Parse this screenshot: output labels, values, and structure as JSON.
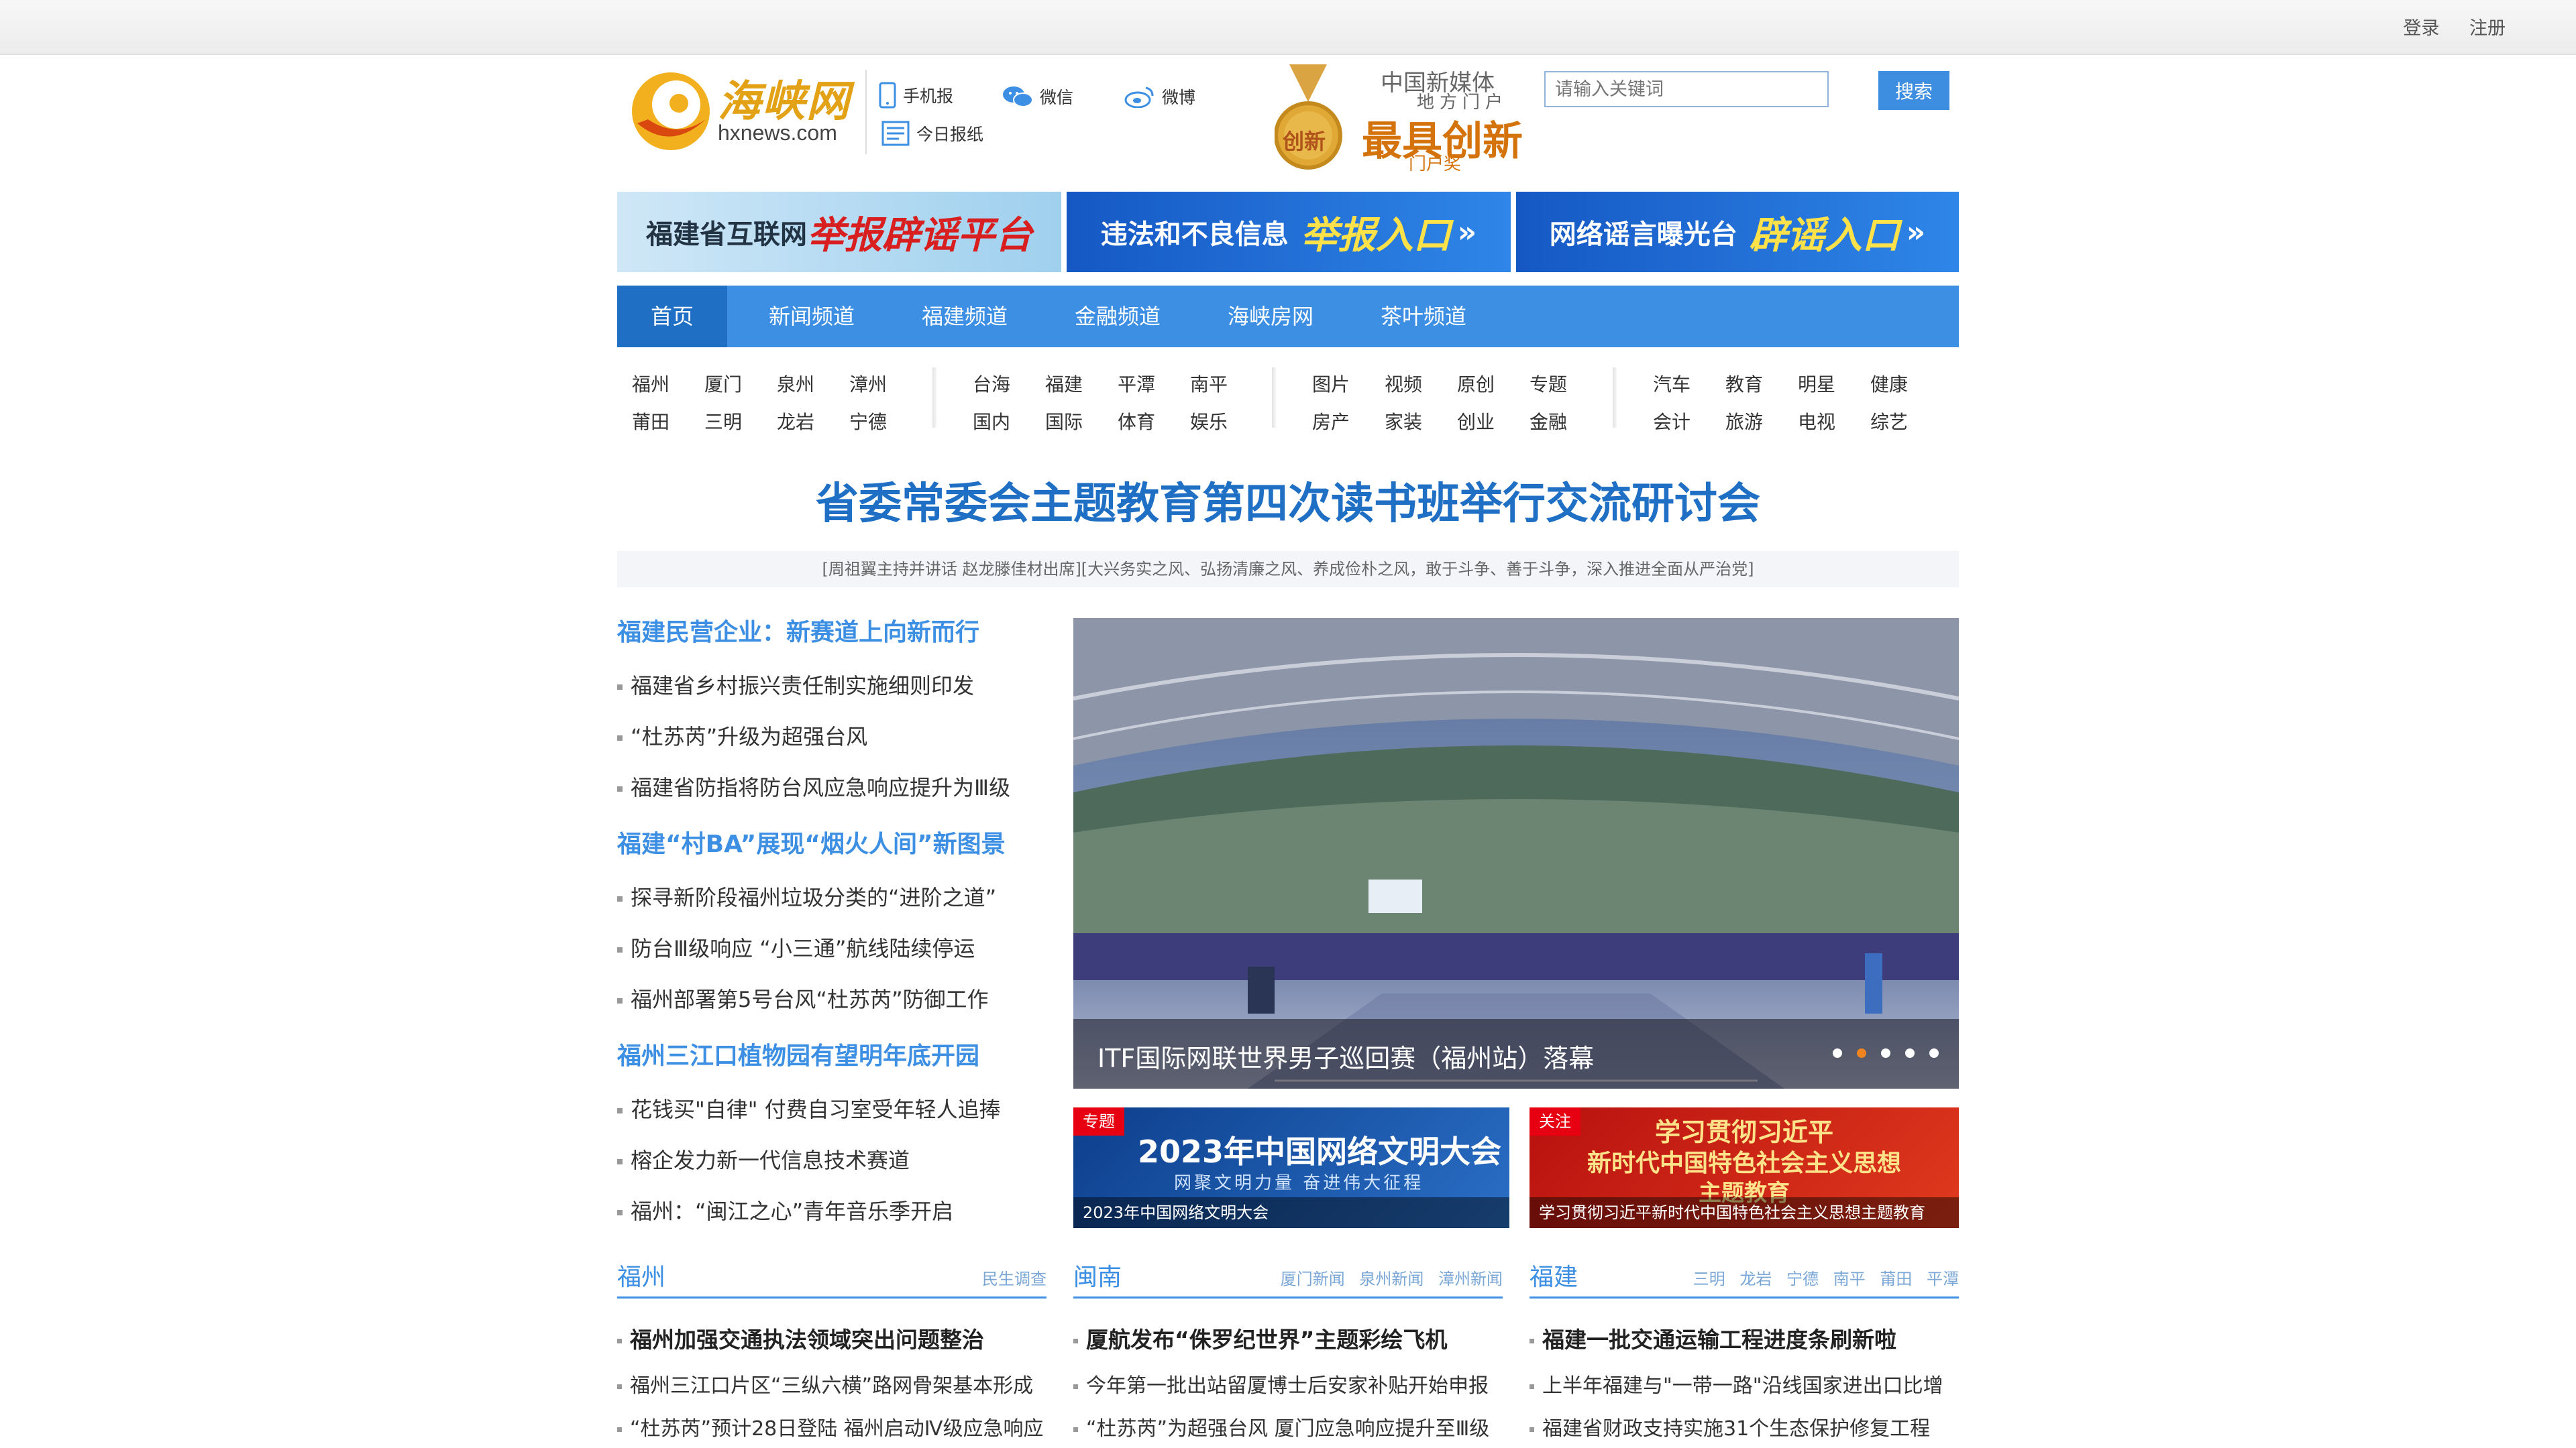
{
  "topbar": {
    "login": "登录",
    "register": "注册"
  },
  "logo": {
    "name": "海峡网",
    "url": "hxnews.com"
  },
  "share": [
    {
      "label": "手机报",
      "icon": "mobile-icon"
    },
    {
      "label": "微信",
      "icon": "wechat-icon"
    },
    {
      "label": "微博",
      "icon": "weibo-icon"
    },
    {
      "label": "今日报纸",
      "icon": "newspaper-icon"
    }
  ],
  "award": {
    "line1": "中国新媒体",
    "line2": "地方门户",
    "line3": "最具创新",
    "line4": "门户奖",
    "badge": "创新"
  },
  "search": {
    "placeholder": "请输入关键词",
    "button": "搜索"
  },
  "banners": [
    {
      "text_a": "福建省互联网",
      "text_b": "举报辟谣平台"
    },
    {
      "text_a": "违法和不良信息",
      "text_b": "举报入口"
    },
    {
      "text_a": "网络谣言曝光台",
      "text_b": "辟谣入口"
    }
  ],
  "nav": {
    "items": [
      "首页",
      "新闻频道",
      "福建频道",
      "金融频道",
      "海峡房网",
      "茶叶频道"
    ],
    "active_index": 0
  },
  "subnav": [
    [
      "福州",
      "厦门",
      "泉州",
      "漳州",
      "莆田",
      "三明",
      "龙岩",
      "宁德"
    ],
    [
      "台海",
      "福建",
      "平潭",
      "南平",
      "国内",
      "国际",
      "体育",
      "娱乐"
    ],
    [
      "图片",
      "视频",
      "原创",
      "专题",
      "房产",
      "家装",
      "创业",
      "金融"
    ],
    [
      "汽车",
      "教育",
      "明星",
      "健康",
      "会计",
      "旅游",
      "电视",
      "综艺"
    ]
  ],
  "headline": {
    "title": "省委常委会主题教育第四次读书班举行交流研讨会",
    "sub": "[周祖翼主持并讲话 赵龙滕佳材出席][大兴务实之风、弘扬清廉之风、养成俭朴之风，敢于斗争、善于斗争，深入推进全面从严治党]"
  },
  "left_news": [
    {
      "title": "福建民营企业：新赛道上向新而行",
      "items": [
        "福建省乡村振兴责任制实施细则印发",
        "“杜苏芮”升级为超强台风",
        "福建省防指将防台风应急响应提升为Ⅲ级"
      ]
    },
    {
      "title": "福建“村BA”展现“烟火人间”新图景",
      "items": [
        "探寻新阶段福州垃圾分类的“进阶之道”",
        "防台Ⅲ级响应 “小三通”航线陆续停运",
        "福州部署第5号台风“杜苏芮”防御工作"
      ]
    },
    {
      "title": "福州三江口植物园有望明年底开园",
      "items": [
        "花钱买\"自律\" 付费自习室受年轻人追捧",
        "榕企发力新一代信息技术赛道",
        "福州：“闽江之心”青年音乐季开启"
      ]
    }
  ],
  "slideshow": {
    "caption": "ITF国际网联世界男子巡回赛（福州站）落幕",
    "slide_count": 5,
    "active_slide": 2
  },
  "promos": [
    {
      "tag": "专题",
      "caption": "2023年中国网络文明大会",
      "title": "2023年中国网络文明大会",
      "slogan": "网聚文明力量 奋进伟大征程"
    },
    {
      "tag": "关注",
      "caption": "学习贯彻习近平新时代中国特色社会主义思想主题教育",
      "line1": "学习贯彻习近平",
      "line2": "新时代中国特色社会主义思想",
      "line3": "主题教育"
    }
  ],
  "columns": [
    {
      "title": "福州",
      "links": [
        "民生调查"
      ],
      "lead": "福州加强交通执法领域突出问题整治",
      "items": [
        "福州三江口片区“三纵六横”路网骨架基本形成",
        "“杜苏芮”预计28日登陆 福州启动Ⅳ级应急响应"
      ]
    },
    {
      "title": "闽南",
      "links": [
        "厦门新闻",
        "泉州新闻",
        "漳州新闻"
      ],
      "lead": "厦航发布“侏罗纪世界”主题彩绘飞机",
      "items": [
        "今年第一批出站留厦博士后安家补贴开始申报",
        "“杜苏芮”为超强台风 厦门应急响应提升至Ⅲ级"
      ]
    },
    {
      "title": "福建",
      "links": [
        "三明",
        "龙岩",
        "宁德",
        "南平",
        "莆田",
        "平潭"
      ],
      "lead": "福建一批交通运输工程进度条刷新啦",
      "items": [
        "上半年福建与\"一带一路\"沿线国家进出口比增",
        "福建省财政支持实施31个生态保护修复工程"
      ]
    }
  ],
  "colors": {
    "brand_blue": "#3c8fe3",
    "nav_active": "#1f6fc4",
    "headline": "#1f6fc4",
    "accent_orange": "#f08520",
    "tag_red": "#e60012"
  }
}
